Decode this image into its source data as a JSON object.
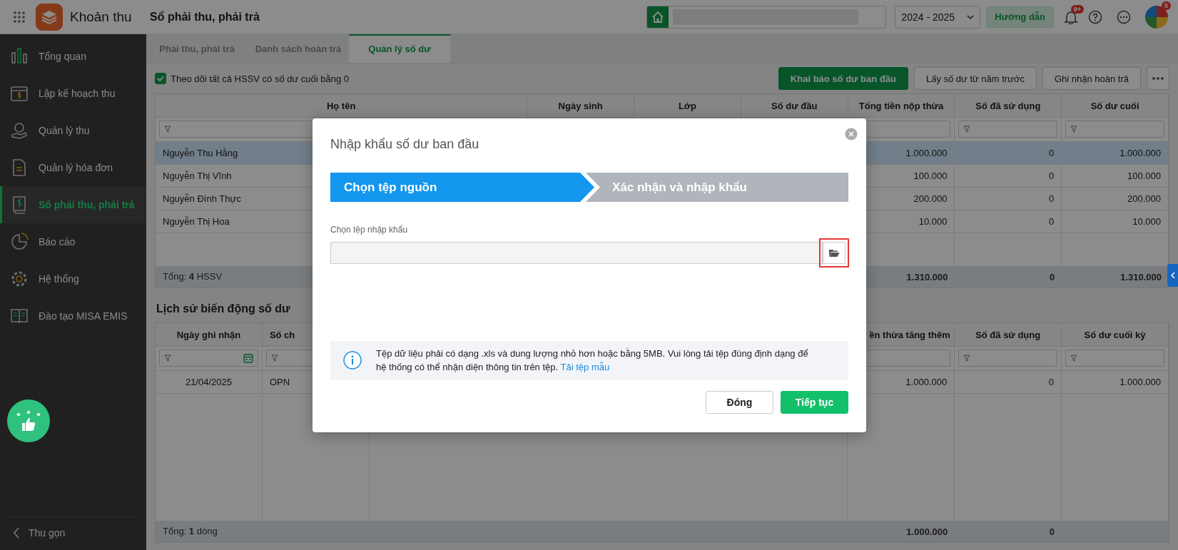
{
  "app": {
    "title": "Khoản thu",
    "page_title": "Sổ phải thu, phải trả"
  },
  "topbar": {
    "school_year": "2024 - 2025",
    "guide_button": "Hướng dẫn",
    "notification_badge": "9+",
    "avatar_badge": "5"
  },
  "sidebar": {
    "items": [
      {
        "label": "Tổng quan",
        "selected": false
      },
      {
        "label": "Lập kế hoạch thu",
        "selected": false
      },
      {
        "label": "Quản lý thu",
        "selected": false
      },
      {
        "label": "Quản lý hóa đơn",
        "selected": false
      },
      {
        "label": "Sổ phải thu, phải trả",
        "selected": true
      },
      {
        "label": "Báo cáo",
        "selected": false
      },
      {
        "label": "Hệ thống",
        "selected": false
      },
      {
        "label": "Đào tạo MISA EMIS",
        "selected": false
      }
    ],
    "collapse": "Thu gọn"
  },
  "tabs": [
    {
      "label": "Phải thu, phải trả",
      "selected": false
    },
    {
      "label": "Danh sách hoàn trả",
      "selected": false
    },
    {
      "label": "Quản lý số dư",
      "selected": true
    }
  ],
  "toolbar": {
    "track_zero_balance": {
      "label": "Theo dõi tất cả HSSV có số dư cuối bằng 0",
      "checked": true
    },
    "buttons": [
      {
        "label": "Khai báo số dư ban đầu",
        "kind": "primary"
      },
      {
        "label": "Lấy số dư từ năm trước",
        "kind": "secondary"
      },
      {
        "label": "Ghi nhận hoàn trả",
        "kind": "secondary"
      }
    ]
  },
  "balance_table": {
    "columns": [
      "Họ tên",
      "Ngày sinh",
      "Lớp",
      "Số dư đầu",
      "Tổng tiền nộp thừa",
      "Số đã sử dụng",
      "Số dư cuối"
    ],
    "rows": [
      {
        "name": "Nguyễn Thu Hằng",
        "overpaid": "1.000.000",
        "used": "0",
        "ending": "1.000.000",
        "selected": true
      },
      {
        "name": "Nguyễn Thị Vĩnh",
        "overpaid": "100.000",
        "used": "0",
        "ending": "100.000",
        "selected": false
      },
      {
        "name": "Nguyễn Đình Thực",
        "overpaid": "200.000",
        "used": "0",
        "ending": "200.000",
        "selected": false
      },
      {
        "name": "Nguyễn Thị Hoa",
        "overpaid": "10.000",
        "used": "0",
        "ending": "10.000",
        "selected": false
      }
    ],
    "footer": {
      "label": "Tổng: **4** HSSV",
      "overpaid": "1.310.000",
      "used": "0",
      "ending": "1.310.000"
    }
  },
  "history": {
    "title": "Lịch sử biến động số dư",
    "columns": [
      "Ngày ghi nhận",
      "Số ch",
      "ền thừa tăng thêm",
      "Số đã sử dụng",
      "Số dư cuối kỳ"
    ],
    "rows": [
      {
        "date": "21/04/2025",
        "voucher": "OPN",
        "increase": "1.000.000",
        "used": "0",
        "ending": "1.000.000"
      }
    ],
    "footer": {
      "label": "Tổng: **1** dòng",
      "increase": "1.000.000",
      "used": "0"
    }
  },
  "modal": {
    "title": "Nhập khẩu số dư ban đầu",
    "steps": [
      {
        "label": "Chọn tệp nguồn",
        "selected": true
      },
      {
        "label": "Xác nhận và nhập khẩu",
        "selected": false
      }
    ],
    "file_label": "Chọn tệp nhập khẩu",
    "info": "Tệp dữ liệu phải có dạng .xls và dung lượng nhỏ hơn hoặc bằng 5MB. Vui lòng tải tệp đúng định dạng để hệ thống có thể nhận diện thông tin trên tệp.",
    "info_link": "Tải tệp mẫu",
    "buttons": [
      {
        "label": "Đóng",
        "kind": "secondary"
      },
      {
        "label": "Tiếp tục",
        "kind": "primary"
      }
    ]
  }
}
